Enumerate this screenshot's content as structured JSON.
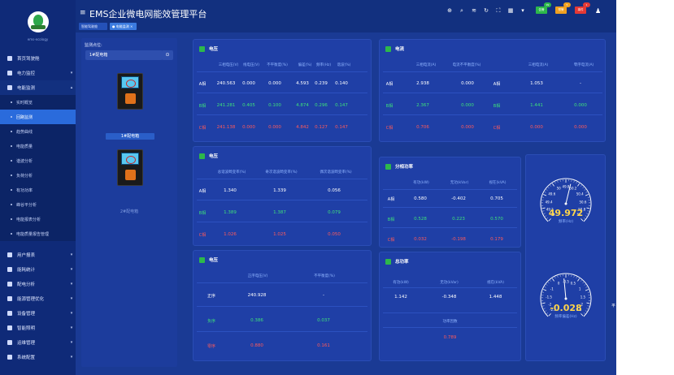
{
  "app": {
    "title": "EMS企业微电网能效管理平台",
    "logo_text": "ems-ecology"
  },
  "breadcrumbs": [
    {
      "label": "智能驾驶舱"
    },
    {
      "label": "● 电能监测 ×"
    }
  ],
  "header": {
    "btn_green": "告警",
    "btn_yellow": "预警",
    "btn_red": "事件",
    "badge_green": "99",
    "badge_yellow": "5",
    "badge_red": "1"
  },
  "sidebar": {
    "items": [
      {
        "label": "首页驾驶舱",
        "chev": ""
      },
      {
        "label": "电力监控",
        "chev": "▾"
      },
      {
        "label": "电能监测",
        "chev": "▴"
      }
    ],
    "sub_items": [
      {
        "label": "实时概览"
      },
      {
        "label": "回路监测"
      },
      {
        "label": "趋势曲线"
      },
      {
        "label": "电能质量"
      },
      {
        "label": "谐波分析"
      },
      {
        "label": "负荷分析"
      },
      {
        "label": "有功功率"
      },
      {
        "label": "峰谷平分析"
      },
      {
        "label": "电能报表分析"
      },
      {
        "label": "电能质量报告管理"
      }
    ],
    "items2": [
      {
        "label": "用户报表",
        "chev": "▾"
      },
      {
        "label": "能耗统计",
        "chev": "▾"
      },
      {
        "label": "配电分析",
        "chev": "▾"
      },
      {
        "label": "能源管理优化",
        "chev": "▾"
      },
      {
        "label": "设备管理",
        "chev": "▾"
      },
      {
        "label": "智能照明",
        "chev": "▾"
      },
      {
        "label": "运维管理",
        "chev": "▾"
      },
      {
        "label": "系统配置",
        "chev": "▾"
      }
    ]
  },
  "left_panel": {
    "label": "监测点位:",
    "select_value": "1#配电箱",
    "btn": "⊙",
    "devices": [
      {
        "label": "1#配电箱"
      },
      {
        "label": "2#配电箱"
      }
    ]
  },
  "panels": {
    "voltage": {
      "title": "电压",
      "headers": [
        "三相电压(V)",
        "线电压(V)",
        "不平衡度(%)",
        "偏差(%)",
        "频率(Hz)",
        "谐波(%)"
      ],
      "rows": [
        {
          "label": "A相",
          "values": [
            "240.563",
            "0.000",
            "0.000",
            "4.593",
            "0.239",
            "0.140"
          ]
        },
        {
          "label": "B相",
          "values": [
            "241.281",
            "0.405",
            "0.100",
            "4.874",
            "0.296",
            "0.147"
          ]
        },
        {
          "label": "C相",
          "values": [
            "241.138",
            "0.000",
            "0.000",
            "4.842",
            "0.127",
            "0.147"
          ]
        }
      ]
    },
    "current": {
      "title": "电流",
      "headers": [
        "三相电流(A)",
        "电流不平衡度(%)",
        "三相电流(A)",
        "零序电流(A)"
      ],
      "rows": [
        {
          "label": "A相",
          "values": [
            "2.938",
            "0.000"
          ],
          "label2": "A相",
          "values2": [
            "1.053",
            "-"
          ]
        },
        {
          "label": "B相",
          "values": [
            "2.367",
            "0.000"
          ],
          "label2": "B相",
          "values2": [
            "1.441",
            "0.000"
          ]
        },
        {
          "label": "C相",
          "values": [
            "0.706",
            "0.000"
          ],
          "label2": "C相",
          "values2": [
            "0.000",
            "0.000"
          ]
        }
      ]
    },
    "harmonic": {
      "title": "电压",
      "headers": [
        "总谐波畸变率(%)",
        "奇次谐波畸变率(%)",
        "偶次谐波畸变率(%)"
      ],
      "rows": [
        {
          "label": "A相",
          "values": [
            "1.340",
            "1.339",
            "0.056"
          ]
        },
        {
          "label": "B相",
          "values": [
            "1.389",
            "1.387",
            "0.079"
          ]
        },
        {
          "label": "C相",
          "values": [
            "1.026",
            "1.025",
            "0.050"
          ]
        }
      ]
    },
    "power": {
      "title": "分相功率",
      "headers": [
        "有功(kW)",
        "无功(kVar)",
        "视在(kVA)"
      ],
      "rows": [
        {
          "label": "A相",
          "values": [
            "0.580",
            "-0.402",
            "0.705"
          ]
        },
        {
          "label": "B相",
          "values": [
            "0.528",
            "0.223",
            "0.570"
          ]
        },
        {
          "label": "C相",
          "values": [
            "0.032",
            "-0.198",
            "0.179"
          ]
        }
      ]
    },
    "total_power": {
      "title": "总功率",
      "headers": [
        "有功(kW)",
        "无功(kVar)",
        "视在(kVA)"
      ],
      "values": [
        "1.142",
        "-0.348",
        "1.448"
      ],
      "pf_label": "功率因数",
      "pf_value": "0.789"
    },
    "voltage2": {
      "title": "电压",
      "headers": [
        "正序电压(V)",
        "不平衡度(%)"
      ],
      "rows": [
        {
          "label": "正序",
          "values": [
            "240.928",
            "-"
          ]
        },
        {
          "label": "负序",
          "values": [
            "0.386",
            "0.037"
          ]
        },
        {
          "label": "零序",
          "values": [
            "0.880",
            "0.161"
          ]
        }
      ]
    }
  },
  "gauges": [
    {
      "value": "49.972",
      "label": "频率(Hz)",
      "fraction": 0.55,
      "ticks": [
        "49.8",
        "50",
        "50.2",
        "49.6",
        "50.4",
        "49.4",
        "50.6",
        "49.2",
        "50.8",
        "49",
        "51"
      ]
    },
    {
      "value": "-0.028",
      "label": "频率偏差(Hz)",
      "fraction": 0.48,
      "ticks": [
        "-0.5",
        "0",
        "0.5",
        "-1",
        "1",
        "-1.5",
        "1.5",
        "-2",
        "2",
        "-2.5",
        "2.5"
      ]
    }
  ],
  "side_label": "平",
  "colors": {
    "accent": "#2a6bdc",
    "a_phase": "#ffffff",
    "b_phase": "#3ee07a",
    "c_phase": "#ff5a5a",
    "gauge_value": "#ffd54a"
  }
}
